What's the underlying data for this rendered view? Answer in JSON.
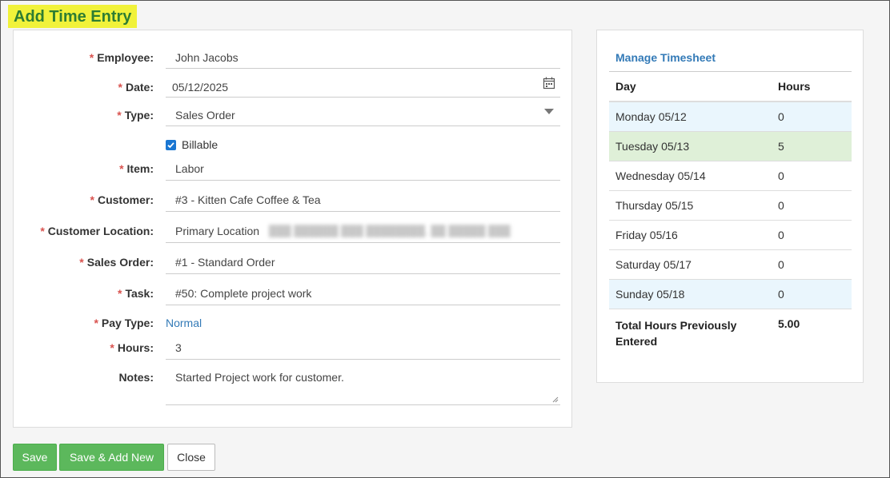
{
  "page_title": "Add Time Entry",
  "required_marker": "*",
  "form": {
    "employee": {
      "label": "Employee:",
      "value": "John Jacobs"
    },
    "date": {
      "label": "Date:",
      "value": "05/12/2025"
    },
    "type": {
      "label": "Type:",
      "value": "Sales Order"
    },
    "billable": {
      "label": "Billable",
      "checked": true
    },
    "item": {
      "label": "Item:",
      "value": "Labor"
    },
    "customer": {
      "label": "Customer:",
      "value": "#3 - Kitten Cafe Coffee & Tea"
    },
    "customer_location": {
      "label": "Customer Location:",
      "value": "Primary Location"
    },
    "sales_order": {
      "label": "Sales Order:",
      "value": "#1 - Standard Order"
    },
    "task": {
      "label": "Task:",
      "value": "#50: Complete project work"
    },
    "pay_type": {
      "label": "Pay Type:",
      "value": "Normal"
    },
    "hours": {
      "label": "Hours:",
      "value": "3"
    },
    "notes": {
      "label": "Notes:",
      "value": "Started Project work for customer."
    }
  },
  "timesheet": {
    "title": "Manage Timesheet",
    "headers": {
      "day": "Day",
      "hours": "Hours"
    },
    "rows": [
      {
        "day": "Monday 05/12",
        "hours": "0"
      },
      {
        "day": "Tuesday 05/13",
        "hours": "5"
      },
      {
        "day": "Wednesday 05/14",
        "hours": "0"
      },
      {
        "day": "Thursday 05/15",
        "hours": "0"
      },
      {
        "day": "Friday 05/16",
        "hours": "0"
      },
      {
        "day": "Saturday 05/17",
        "hours": "0"
      },
      {
        "day": "Sunday 05/18",
        "hours": "0"
      }
    ],
    "total_label": "Total Hours Previously Entered",
    "total_value": "5.00"
  },
  "buttons": {
    "save": "Save",
    "save_add_new": "Save & Add New",
    "close": "Close"
  },
  "colors": {
    "title_highlight": "#f1f23a",
    "title_text": "#2e7d32",
    "button_green": "#5cb85c",
    "link_blue": "#337ab7",
    "required_red": "#d9534f",
    "row_highlight_today": "#eaf6fd",
    "row_highlight_hours": "#dff0d8"
  }
}
